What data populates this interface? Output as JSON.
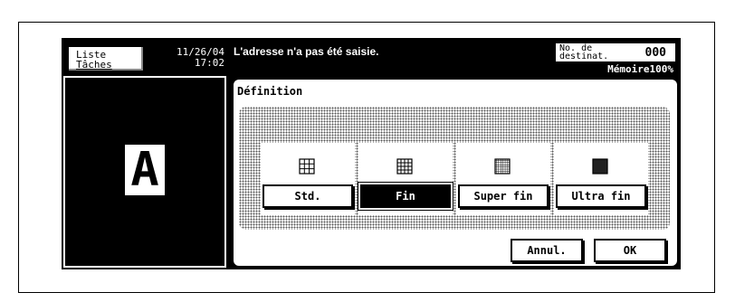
{
  "left_panel": {
    "jobs_button": {
      "line1": "Liste",
      "line2": "Tâches"
    },
    "date": "11/26/04",
    "time": "17:02",
    "preview_letter": "A"
  },
  "header": {
    "message": "L'adresse n'a pas été saisie.",
    "destinations_label_1": "No. de",
    "destinations_label_2": "destinat.",
    "destinations_count": "000",
    "memory": "Mémoire100%"
  },
  "panel": {
    "title": "Définition",
    "options": [
      {
        "label": "Std.",
        "icon": "grid-coarse-icon",
        "selected": false
      },
      {
        "label": "Fin",
        "icon": "grid-fine-icon",
        "selected": true
      },
      {
        "label": "Super fin",
        "icon": "grid-superfine-icon",
        "selected": false
      },
      {
        "label": "Ultra fin",
        "icon": "grid-ultrafine-icon",
        "selected": false
      }
    ],
    "cancel_label": "Annul.",
    "ok_label": "OK"
  }
}
